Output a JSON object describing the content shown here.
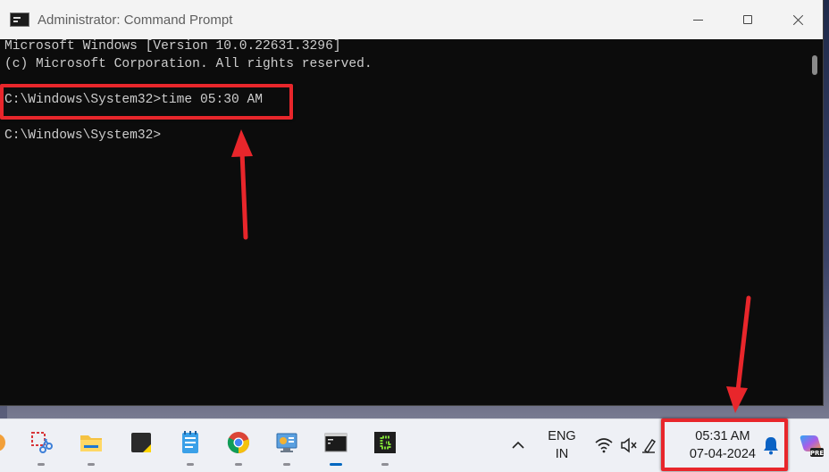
{
  "window": {
    "title": "Administrator: Command Prompt"
  },
  "console": {
    "lines": [
      "Microsoft Windows [Version 10.0.22631.3296]",
      "(c) Microsoft Corporation. All rights reserved.",
      "",
      "C:\\Windows\\System32>time 05:30 AM",
      "",
      "C:\\Windows\\System32>"
    ]
  },
  "taskbar": {
    "apps": [
      {
        "icon": "snipping-tool-icon"
      },
      {
        "icon": "file-explorer-icon"
      },
      {
        "icon": "sticky-notes-icon"
      },
      {
        "icon": "notepad-icon"
      },
      {
        "icon": "chrome-icon"
      },
      {
        "icon": "control-panel-icon"
      },
      {
        "icon": "command-prompt-icon"
      },
      {
        "icon": "greenshot-icon"
      }
    ],
    "tray": {
      "language_line1": "ENG",
      "language_line2": "IN",
      "time": "05:31 AM",
      "date": "07-04-2024"
    }
  },
  "colors": {
    "annotation": "#e8262b",
    "console_bg": "#0c0c0c",
    "console_text": "#cccccc",
    "taskbar_bg": "#eef0f5"
  }
}
